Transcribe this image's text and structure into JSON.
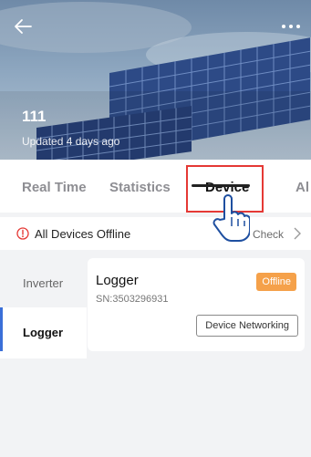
{
  "header": {
    "back_icon": "arrow-left-icon",
    "more_icon": "more-dots-icon",
    "plant_name": "111",
    "updated_text": "Updated 4 days ago"
  },
  "tabs": [
    {
      "label": "Real Time",
      "active": false
    },
    {
      "label": "Statistics",
      "active": false
    },
    {
      "label": "Device",
      "active": true
    },
    {
      "label": "Al",
      "active": false
    }
  ],
  "banner": {
    "icon": "warning-circle-icon",
    "message": "All Devices Offline",
    "action_label": "Check",
    "chevron_icon": "chevron-right-icon"
  },
  "sidebar": {
    "items": [
      {
        "label": "Inverter",
        "selected": false
      },
      {
        "label": "Logger",
        "selected": true
      }
    ]
  },
  "device_card": {
    "name": "Logger",
    "serial": "SN:3503296931",
    "status": "Offline",
    "networking_button": "Device Networking"
  },
  "colors": {
    "status_offline": "#f5a14a",
    "selected_indicator": "#3a6fd8",
    "highlight": "#e53935"
  }
}
